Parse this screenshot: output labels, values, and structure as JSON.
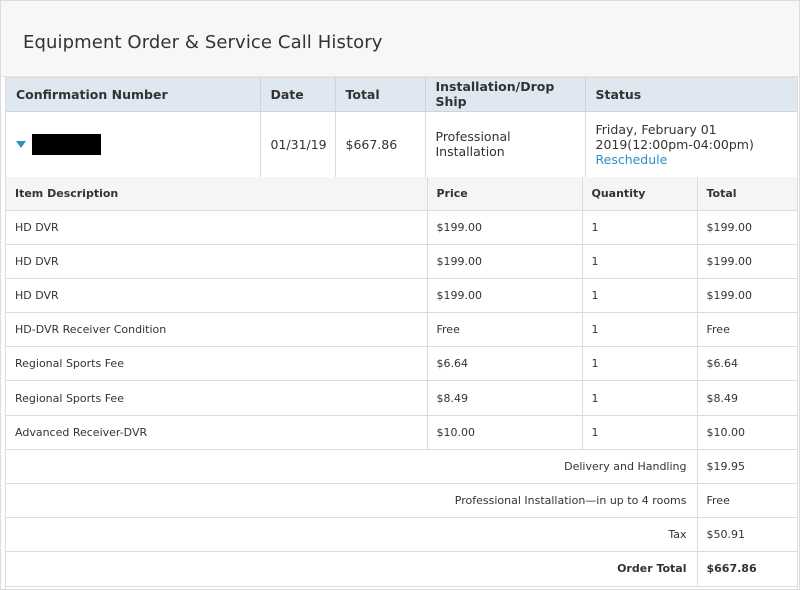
{
  "page": {
    "title": "Equipment Order & Service Call History"
  },
  "order_table": {
    "headers": [
      "Confirmation Number",
      "Date",
      "Total",
      "Installation/Drop Ship",
      "Status"
    ],
    "row": {
      "date": "01/31/19",
      "total": "$667.86",
      "installation": "Professional Installation",
      "status_line1": "Friday, February 01",
      "status_line2": "2019(12:00pm-04:00pm)",
      "reschedule_link": "Reschedule"
    }
  },
  "items_table": {
    "headers": [
      "Item Description",
      "Price",
      "Quantity",
      "Total"
    ],
    "rows": [
      {
        "description": "HD DVR",
        "price": "$199.00",
        "quantity": "1",
        "total": "$199.00"
      },
      {
        "description": "HD DVR",
        "price": "$199.00",
        "quantity": "1",
        "total": "$199.00"
      },
      {
        "description": "HD DVR",
        "price": "$199.00",
        "quantity": "1",
        "total": "$199.00"
      },
      {
        "description": "HD-DVR Receiver Condition",
        "price": "Free",
        "quantity": "1",
        "total": "Free"
      },
      {
        "description": "Regional Sports Fee",
        "price": "$6.64",
        "quantity": "1",
        "total": "$6.64"
      },
      {
        "description": "Regional Sports Fee",
        "price": "$8.49",
        "quantity": "1",
        "total": "$8.49"
      },
      {
        "description": "Advanced Receiver-DVR",
        "price": "$10.00",
        "quantity": "1",
        "total": "$10.00"
      }
    ],
    "summary": [
      {
        "label": "Delivery and Handling",
        "value": "$19.95"
      },
      {
        "label": "Professional Installation—in up to 4 rooms",
        "value": "Free"
      },
      {
        "label": "Tax",
        "value": "$50.91"
      },
      {
        "label": "Order Total",
        "value": "$667.86"
      }
    ]
  },
  "colors": {
    "link": "#2a91c6",
    "summary_value": "#3c8c2c",
    "header_bg": "#dfe8f0"
  },
  "icons": {
    "expand": "caret-down-icon"
  }
}
